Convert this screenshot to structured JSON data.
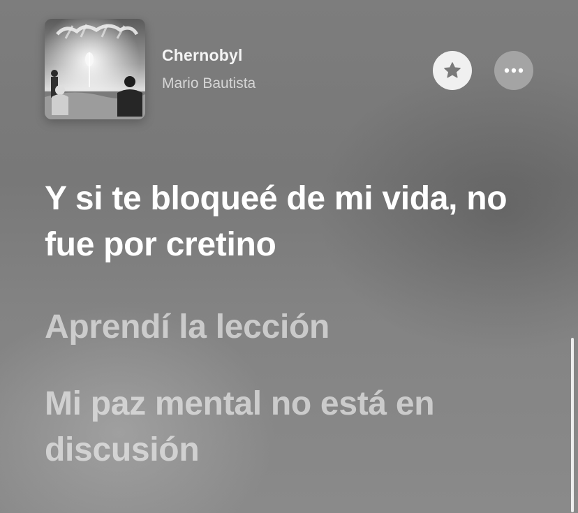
{
  "now_playing": {
    "artwork_icon": "album-artwork-image",
    "title": "Chernobyl",
    "artist": "Mario Bautista",
    "favorite_icon": "star-icon",
    "more_icon": "ellipsis-icon"
  },
  "lyrics": {
    "active_line": "Y si te bloqueé de mi vida, no fue por cretino",
    "next_lines": [
      "Aprendí la lección",
      "Mi paz mental no está en discusión"
    ]
  },
  "colors": {
    "background": "#7d7d7d",
    "active_lyric": "#ffffff",
    "inactive_lyric": "#c9c9c9"
  }
}
